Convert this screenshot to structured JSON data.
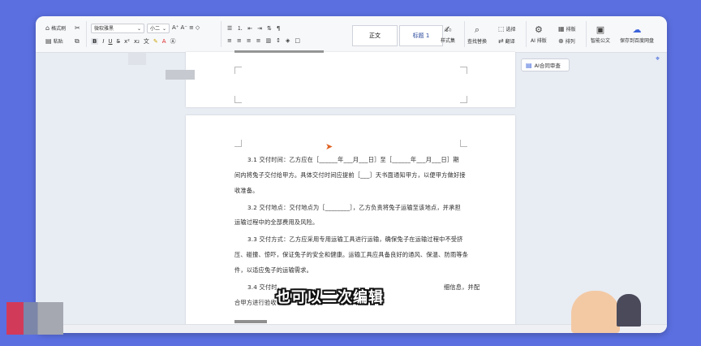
{
  "ribbon": {
    "format_painter": "格式刷",
    "paste": "粘贴",
    "font_name": "微软雅黑",
    "font_size": "小二",
    "style_normal": "正文",
    "style_heading1": "标题 1",
    "style_set": "样式集",
    "find_replace": "查找替换",
    "select": "选择",
    "translate": "翻译",
    "ai_layout": "AI 排版",
    "layout": "排版",
    "arrange": "排列",
    "smart_doc": "智能公文",
    "save_cloud": "保存到百度网盘"
  },
  "side_panel": {
    "ai_contract_review": "AI合同审查"
  },
  "document": {
    "lines": [
      "3.1 交付时间：乙方应在［______年___月___日］至［______年___月___日］期",
      "间内将兔子交付给甲方。具体交付时间应提前［___］天书面通知甲方，以便甲方做好接",
      "收准备。",
      "3.2 交付地点：交付地点为［________］，乙方负责将兔子运输至该地点，并承担",
      "运输过程中的全部费用及风险。",
      "3.3 交付方式：乙方应采用专用运输工具进行运输，确保兔子在运输过程中不受挤",
      "压、碰撞、惊吓，保证兔子的安全和健康。运输工具应具备良好的通风、保温、防雨等条",
      "件，以适应兔子的运输需求。",
      "3.4 交付时，",
      "合甲方进行验收",
      "细信息，并配"
    ]
  },
  "overlay": {
    "caption": "也可以二次编辑"
  },
  "colors": {
    "background": "#5b6fe0",
    "caption_text": "#ffffff"
  }
}
